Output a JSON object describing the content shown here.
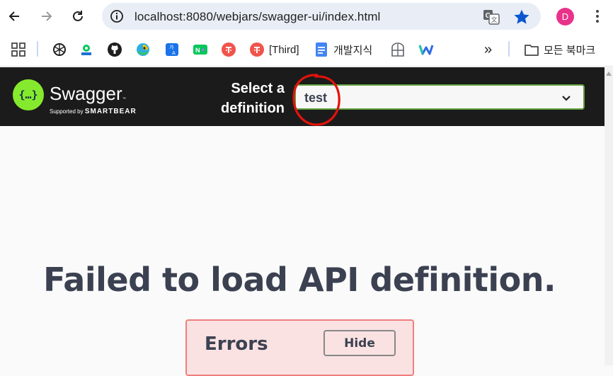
{
  "browser": {
    "url": "localhost:8080/webjars/swagger-ui/index.html",
    "avatar_letter": "D",
    "accent": "#0b57d0"
  },
  "bookmarks": {
    "items": [
      {
        "icon": "apps-grid-icon"
      },
      {
        "icon": "openai-icon"
      },
      {
        "icon": "map-pin-icon"
      },
      {
        "icon": "github-icon"
      },
      {
        "icon": "chat-bird-icon"
      },
      {
        "icon": "dictionary-icon"
      },
      {
        "icon": "naver-plus-icon"
      },
      {
        "icon": "red-circle-icon"
      },
      {
        "icon": "red-circle-icon",
        "label": "[Third]"
      },
      {
        "icon": "google-docs-icon",
        "label": "개발지식"
      },
      {
        "icon": "globe-icon"
      },
      {
        "icon": "w-logo-icon"
      }
    ],
    "overflow_label": "»",
    "folder_label": "모든 북마크"
  },
  "swagger": {
    "brand": "Swagger",
    "supported_by": "Supported by",
    "smartbear": "SMARTBEAR",
    "select_label_line1": "Select a",
    "select_label_line2": "definition",
    "selected_definition": "test",
    "logo_glyph": "{…}",
    "brand_color": "#85ea2d"
  },
  "main": {
    "message": "Failed to load API definition.",
    "errors_title": "Errors",
    "hide_button": "Hide"
  }
}
